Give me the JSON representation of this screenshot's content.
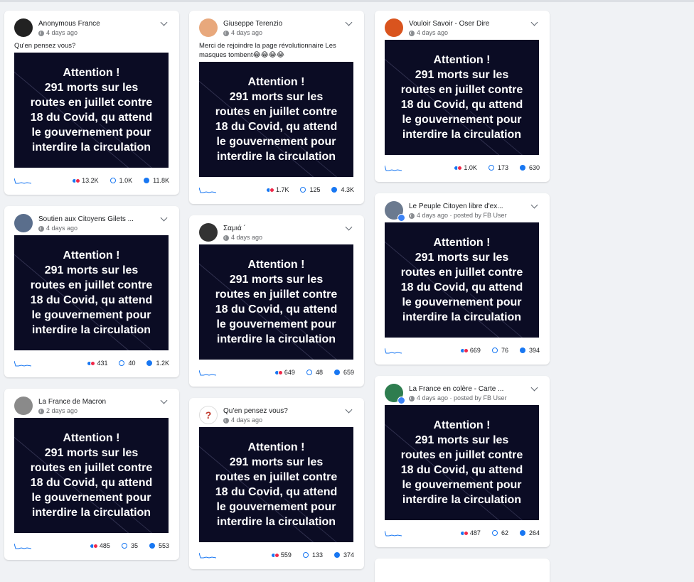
{
  "image_text": "Attention !\n291 morts sur les\nroutes en juillet contre\n18 du Covid, qu attend\nle gouvernement pour\ninterdire la circulation",
  "colors": {
    "background": "#f0f2f5",
    "card": "#ffffff",
    "accent": "#1877f2",
    "image_bg": "#0b0c24"
  },
  "icons": {
    "privacy": "globe-icon",
    "menu": "chevron-down-icon",
    "reactions": "reaction-icon",
    "comments": "comment-icon",
    "shares": "share-icon"
  },
  "columns": [
    [
      {
        "name": "Anonymous France",
        "time": "4 days ago",
        "caption": "Qu'en pensez vous?",
        "reactions": "13.2K",
        "comments": "1.0K",
        "shares": "11.8K",
        "avatar": "#222222",
        "badge": false
      },
      {
        "name": "Soutien aux Citoyens Gilets ...",
        "time": "4 days ago",
        "caption": "",
        "reactions": "431",
        "comments": "40",
        "shares": "1.2K",
        "avatar": "#5a6e8c",
        "badge": false
      },
      {
        "name": "La France de Macron",
        "time": "2 days ago",
        "caption": "",
        "reactions": "485",
        "comments": "35",
        "shares": "553",
        "avatar": "#8a8a8a",
        "badge": false
      }
    ],
    [
      {
        "name": "Giuseppe Terenzio",
        "time": "4 days ago",
        "caption": "Merci de rejoindre la page révolutionnaire Les masques tombent😂😂😂😂",
        "reactions": "1.7K",
        "comments": "125",
        "shares": "4.3K",
        "avatar": "#e8a87c",
        "badge": false
      },
      {
        "name": "Σαμιά ´",
        "time": "4 days ago",
        "caption": "",
        "reactions": "649",
        "comments": "48",
        "shares": "659",
        "avatar": "#333333",
        "badge": false
      },
      {
        "name": "Qu'en pensez vous?",
        "time": "4 days ago",
        "caption": "",
        "reactions": "559",
        "comments": "133",
        "shares": "374",
        "avatar": "#ffffff",
        "badge": false,
        "glyph": "?"
      }
    ],
    [
      {
        "name": "Vouloir Savoir - Oser Dire",
        "time": "4 days ago",
        "caption": "",
        "reactions": "1.0K",
        "comments": "173",
        "shares": "630",
        "avatar": "#d9541e",
        "badge": false
      },
      {
        "name": "Le Peuple Citoyen libre d'ex...",
        "time": "4 days ago · posted by FB User",
        "caption": "",
        "reactions": "669",
        "comments": "76",
        "shares": "394",
        "avatar": "#6b7a8f",
        "badge": true
      },
      {
        "name": "La France en colère - Carte ...",
        "time": "4 days ago · posted by FB User",
        "caption": "",
        "reactions": "487",
        "comments": "62",
        "shares": "264",
        "avatar": "#2e7d4f",
        "badge": true
      }
    ]
  ]
}
